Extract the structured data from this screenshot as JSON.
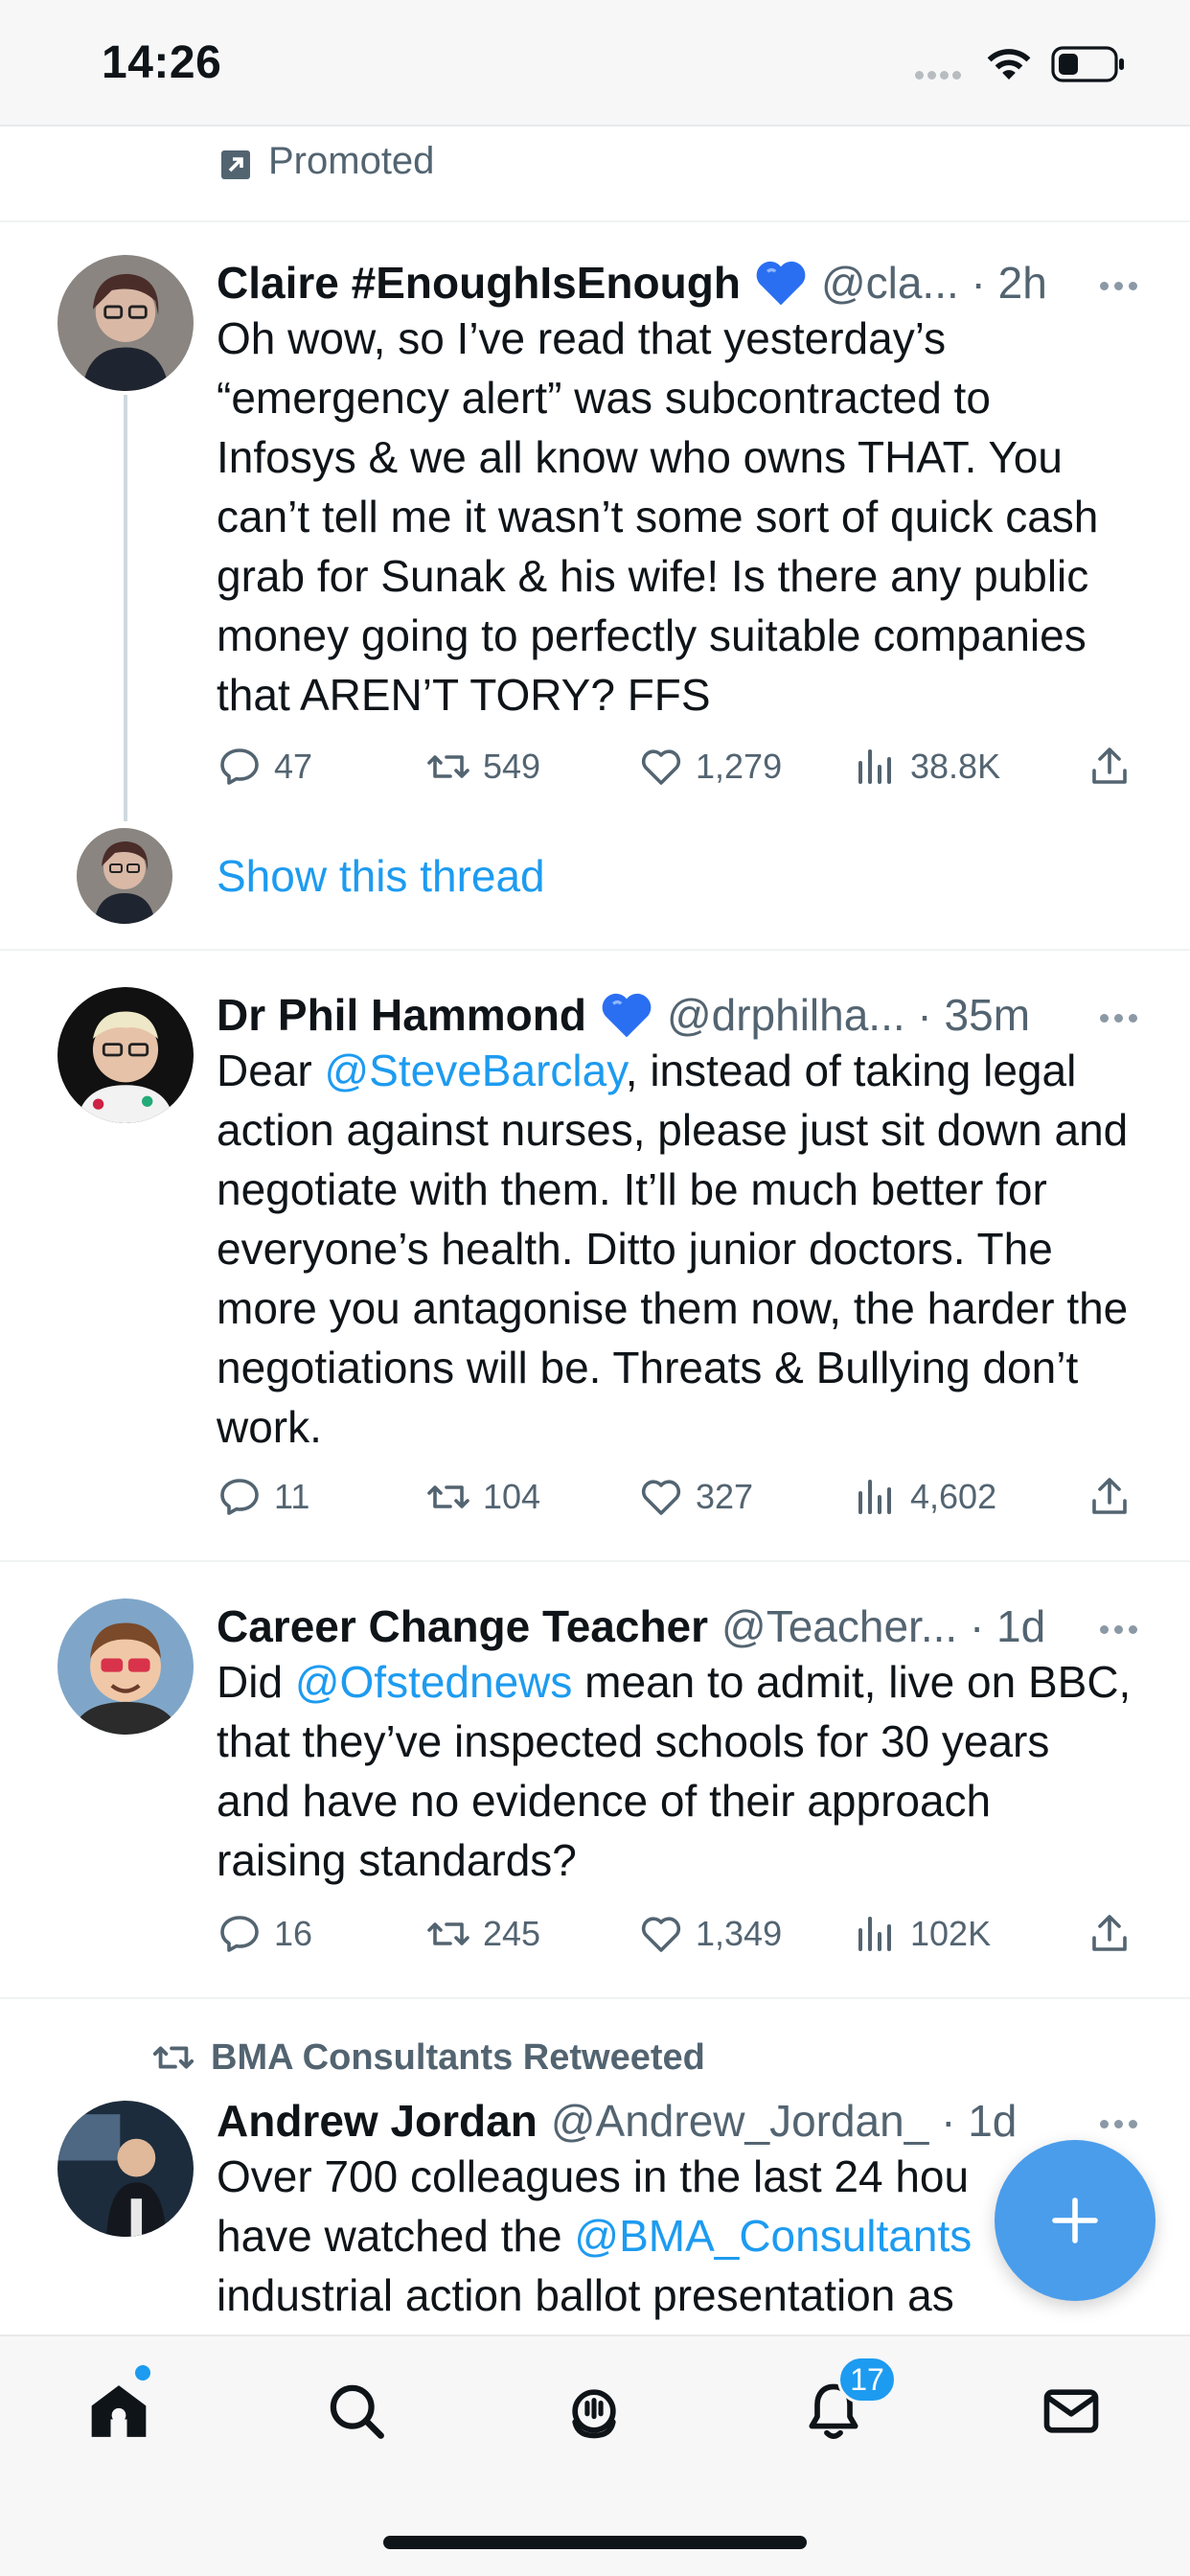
{
  "status_bar": {
    "time": "14:26"
  },
  "promoted": {
    "label": "Promoted"
  },
  "tweets": [
    {
      "name": "Claire #EnoughIsEnough",
      "handle": "@cla... · 2h",
      "text": "Oh wow, so I’ve read that yesterday’s “emergency alert” was subcontracted to Infosys & we all know who owns THAT. You can’t tell me it wasn’t some sort of quick cash grab for Sunak & his wife! Is there any public money going to perfectly suitable companies that AREN’T TORY? FFS",
      "replies": "47",
      "retweets": "549",
      "likes": "1,279",
      "views": "38.8K",
      "show_thread": "Show this thread"
    },
    {
      "name": "Dr Phil Hammond",
      "handle": "@drphilha... · 35m",
      "text_before": "Dear ",
      "mention": "@SteveBarclay",
      "text_after": ", instead of taking legal action against nurses, please just sit down and negotiate with them. It’ll be much better for everyone’s health. Ditto junior doctors. The more you antagonise them now, the harder the negotiations will be. Threats & Bullying don’t work.",
      "replies": "11",
      "retweets": "104",
      "likes": "327",
      "views": "4,602"
    },
    {
      "name": "Career Change Teacher",
      "handle": "@Teacher... · 1d",
      "text_before": "Did ",
      "mention": "@Ofstednews",
      "text_after": " mean to admit, live on BBC, that they’ve inspected schools for 30 years and have no evidence of their approach raising standards?",
      "replies": "16",
      "retweets": "245",
      "likes": "1,349",
      "views": "102K"
    },
    {
      "retweet_context": "BMA Consultants Retweeted",
      "name": "Andrew Jordan",
      "handle": "@Andrew_Jordan_ · 1d",
      "text_before": "Over 700 colleagues in the last 24 hou",
      "text_line2_before": "have watched the ",
      "mention": "@BMA_Consultants",
      "text_line3": "industrial action ballot presentation as"
    }
  ],
  "tabbar": {
    "notifications_badge": "17"
  },
  "icons": [
    "wifi-icon",
    "battery-icon",
    "promoted-icon",
    "more-icon",
    "reply-icon",
    "retweet-icon",
    "like-icon",
    "views-icon",
    "share-icon",
    "compose-plus-icon",
    "home-icon",
    "search-icon",
    "spaces-icon",
    "notifications-icon",
    "messages-icon"
  ],
  "colors": {
    "accent": "#1d9bf0",
    "fab": "#4a9deb",
    "muted": "#536471",
    "heart_emoji": "#2a6ff2"
  }
}
